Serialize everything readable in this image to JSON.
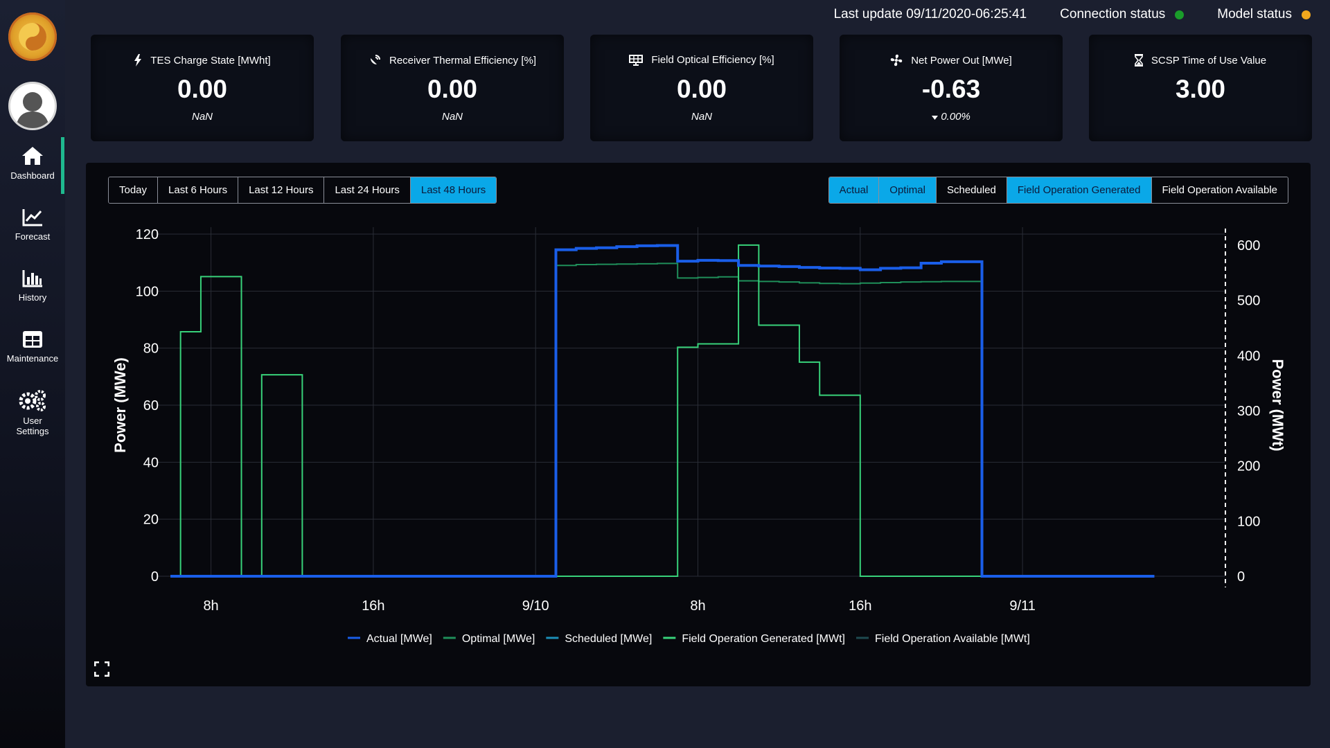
{
  "sidebar": {
    "items": [
      {
        "label": "Dashboard",
        "icon": "home-icon"
      },
      {
        "label": "Forecast",
        "icon": "forecast-chart-icon"
      },
      {
        "label": "History",
        "icon": "bar-chart-icon"
      },
      {
        "label": "Maintenance",
        "icon": "grid-table-icon"
      },
      {
        "label": "User Settings",
        "icon": "gears-icon"
      }
    ],
    "active": "Dashboard"
  },
  "header": {
    "last_update": "Last update 09/11/2020-06:25:41",
    "connection_status": {
      "label": "Connection status",
      "color": "#1a9c2a"
    },
    "model_status": {
      "label": "Model status",
      "color": "#f2a81d"
    }
  },
  "kpis": [
    {
      "title": "TES Charge State [MWht]",
      "value": "0.00",
      "sub": "NaN",
      "icon": "lightning-icon"
    },
    {
      "title": "Receiver Thermal Efficiency [%]",
      "value": "0.00",
      "sub": "NaN",
      "icon": "satellite-dish-icon"
    },
    {
      "title": "Field Optical Efficiency [%]",
      "value": "0.00",
      "sub": "NaN",
      "icon": "solar-panel-icon"
    },
    {
      "title": "Net Power Out [MWe]",
      "value": "-0.63",
      "sub": "0.00%",
      "icon": "fan-icon",
      "sub_icon": "caret-down-icon"
    },
    {
      "title": "SCSP Time of Use Value",
      "value": "3.00",
      "sub": "",
      "icon": "hourglass-icon"
    }
  ],
  "time_range_buttons": {
    "options": [
      "Today",
      "Last 6 Hours",
      "Last 12 Hours",
      "Last 24 Hours",
      "Last 48 Hours"
    ],
    "selected": [
      "Last 48 Hours"
    ]
  },
  "series_buttons": {
    "options": [
      "Actual",
      "Optimal",
      "Scheduled",
      "Field Operation Generated",
      "Field Operation Available"
    ],
    "selected": [
      "Actual",
      "Optimal",
      "Field Operation Generated"
    ]
  },
  "colors": {
    "accent": "#0aa8e8",
    "actual": "#1a5ee8",
    "optimal": "#1f8f5a",
    "scheduled": "#1c8fb8",
    "field_generated": "#38d27a",
    "field_available": "#1e4a50",
    "nav_active": "#1fb98f"
  },
  "chart_data": {
    "type": "line",
    "x_axis": {
      "type": "time",
      "range": [
        "2020-09-09 06:00",
        "2020-09-11 10:00"
      ],
      "tick_labels": [
        {
          "t": "2020-09-09 08:00",
          "label": "8h"
        },
        {
          "t": "2020-09-09 16:00",
          "label": "16h"
        },
        {
          "t": "2020-09-10 00:00",
          "label": "9/10"
        },
        {
          "t": "2020-09-10 08:00",
          "label": "8h"
        },
        {
          "t": "2020-09-10 16:00",
          "label": "16h"
        },
        {
          "t": "2020-09-11 00:00",
          "label": "9/11"
        }
      ]
    },
    "y_left": {
      "label": "Power (MWe)",
      "ylim": [
        0,
        120
      ],
      "ticks": [
        0,
        20,
        40,
        60,
        80,
        100,
        120
      ]
    },
    "y_right": {
      "label": "Power (MWt)",
      "ylim": [
        0,
        620
      ],
      "ticks": [
        0,
        100,
        200,
        300,
        400,
        500,
        600
      ]
    },
    "grid": true,
    "legend_position": "bottom",
    "series": [
      {
        "name": "Actual [MWe]",
        "axis": "left",
        "step": true,
        "width": 4,
        "color": "#1a5ee8",
        "points": [
          [
            "2020-09-09 06:00",
            0
          ],
          [
            "2020-09-10 01:00",
            0
          ],
          [
            "2020-09-10 01:00",
            114.5
          ],
          [
            "2020-09-10 02:00",
            115
          ],
          [
            "2020-09-10 03:00",
            115.2
          ],
          [
            "2020-09-10 04:00",
            115.6
          ],
          [
            "2020-09-10 05:00",
            115.9
          ],
          [
            "2020-09-10 06:00",
            116
          ],
          [
            "2020-09-10 07:00",
            110.5
          ],
          [
            "2020-09-10 08:00",
            110.8
          ],
          [
            "2020-09-10 09:00",
            110.7
          ],
          [
            "2020-09-10 10:00",
            109
          ],
          [
            "2020-09-10 11:00",
            108.8
          ],
          [
            "2020-09-10 12:00",
            108.6
          ],
          [
            "2020-09-10 13:00",
            108.3
          ],
          [
            "2020-09-10 14:00",
            108.1
          ],
          [
            "2020-09-10 15:00",
            108
          ],
          [
            "2020-09-10 16:00",
            107.5
          ],
          [
            "2020-09-10 17:00",
            108
          ],
          [
            "2020-09-10 18:00",
            108.2
          ],
          [
            "2020-09-10 19:00",
            109.8
          ],
          [
            "2020-09-10 20:00",
            110.3
          ],
          [
            "2020-09-10 21:00",
            110.3
          ],
          [
            "2020-09-10 22:00",
            0
          ],
          [
            "2020-09-11 06:30",
            0
          ]
        ]
      },
      {
        "name": "Optimal [MWe]",
        "axis": "left",
        "step": true,
        "width": 2,
        "color": "#1f8f5a",
        "points": [
          [
            "2020-09-09 06:00",
            0
          ],
          [
            "2020-09-10 01:00",
            0
          ],
          [
            "2020-09-10 01:00",
            109
          ],
          [
            "2020-09-10 02:00",
            109.3
          ],
          [
            "2020-09-10 03:00",
            109.4
          ],
          [
            "2020-09-10 04:00",
            109.5
          ],
          [
            "2020-09-10 05:00",
            109.6
          ],
          [
            "2020-09-10 06:00",
            109.7
          ],
          [
            "2020-09-10 07:00",
            104.6
          ],
          [
            "2020-09-10 08:00",
            104.8
          ],
          [
            "2020-09-10 09:00",
            105
          ],
          [
            "2020-09-10 10:00",
            103.6
          ],
          [
            "2020-09-10 11:00",
            103.4
          ],
          [
            "2020-09-10 12:00",
            103.2
          ],
          [
            "2020-09-10 13:00",
            102.9
          ],
          [
            "2020-09-10 14:00",
            102.7
          ],
          [
            "2020-09-10 15:00",
            102.6
          ],
          [
            "2020-09-10 16:00",
            102.8
          ],
          [
            "2020-09-10 17:00",
            103
          ],
          [
            "2020-09-10 18:00",
            103.2
          ],
          [
            "2020-09-10 19:00",
            103.3
          ],
          [
            "2020-09-10 20:00",
            103.4
          ],
          [
            "2020-09-10 21:00",
            103.4
          ],
          [
            "2020-09-10 22:00",
            0
          ],
          [
            "2020-09-11 06:30",
            0
          ]
        ]
      },
      {
        "name": "Field Operation Generated [MWt]",
        "axis": "right",
        "step": true,
        "width": 2,
        "color": "#38d27a",
        "points": [
          [
            "2020-09-09 06:00",
            0
          ],
          [
            "2020-09-09 06:30",
            0
          ],
          [
            "2020-09-09 06:30",
            443
          ],
          [
            "2020-09-09 07:30",
            543
          ],
          [
            "2020-09-09 09:30",
            0
          ],
          [
            "2020-09-09 10:30",
            365
          ],
          [
            "2020-09-09 12:30",
            0
          ],
          [
            "2020-09-10 07:00",
            0
          ],
          [
            "2020-09-10 07:00",
            415
          ],
          [
            "2020-09-10 08:00",
            421
          ],
          [
            "2020-09-10 10:00",
            600
          ],
          [
            "2020-09-10 11:00",
            455
          ],
          [
            "2020-09-10 13:00",
            388
          ],
          [
            "2020-09-10 14:00",
            328
          ],
          [
            "2020-09-10 16:00",
            0
          ],
          [
            "2020-09-10 22:00",
            0
          ]
        ]
      }
    ],
    "legend": [
      {
        "name": "Actual [MWe]",
        "color": "#1a5ee8"
      },
      {
        "name": "Optimal [MWe]",
        "color": "#1f8f5a"
      },
      {
        "name": "Scheduled [MWe]",
        "color": "#1c8fb8"
      },
      {
        "name": "Field Operation Generated [MWt]",
        "color": "#38d27a"
      },
      {
        "name": "Field Operation Available [MWt]",
        "color": "#1e4a50"
      }
    ]
  }
}
